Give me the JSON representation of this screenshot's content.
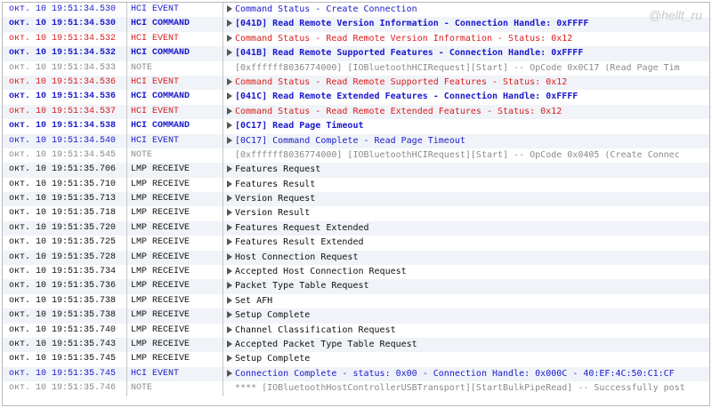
{
  "watermark": "@hellt_ru",
  "colors": {
    "event": "#1a1acc",
    "command": "#1a1acc",
    "error": "#d81c1c",
    "note": "#8a8a8a",
    "lmp": "#111111",
    "row_alt": "#f0f3f8"
  },
  "log_rows": [
    {
      "timestamp": "окт. 10 19:51:34.530",
      "type": "HCI EVENT",
      "message": "Command Status - Create Connection",
      "style": "event",
      "expandable": true
    },
    {
      "timestamp": "окт. 10 19:51:34.530",
      "type": "HCI COMMAND",
      "message": "[041D] Read Remote Version Information - Connection Handle: 0xFFFF",
      "style": "command",
      "expandable": true
    },
    {
      "timestamp": "окт. 10 19:51:34.532",
      "type": "HCI EVENT",
      "message": "Command Status - Read Remote Version Information - Status: 0x12",
      "style": "error",
      "expandable": true
    },
    {
      "timestamp": "окт. 10 19:51:34.532",
      "type": "HCI COMMAND",
      "message": "[041B] Read Remote Supported Features - Connection Handle: 0xFFFF",
      "style": "command",
      "expandable": true
    },
    {
      "timestamp": "окт. 10 19:51:34.533",
      "type": "NOTE",
      "message": "[0xffffff8036774000] [IOBluetoothHCIRequest][Start] --  OpCode 0x0C17 (Read Page Tim",
      "style": "note",
      "expandable": false
    },
    {
      "timestamp": "окт. 10 19:51:34.536",
      "type": "HCI EVENT",
      "message": "Command Status - Read Remote Supported Features - Status: 0x12",
      "style": "error",
      "expandable": true
    },
    {
      "timestamp": "окт. 10 19:51:34.536",
      "type": "HCI COMMAND",
      "message": "[041C] Read Remote Extended Features - Connection Handle: 0xFFFF",
      "style": "command",
      "expandable": true
    },
    {
      "timestamp": "окт. 10 19:51:34.537",
      "type": "HCI EVENT",
      "message": "Command Status - Read Remote Extended Features - Status: 0x12",
      "style": "error",
      "expandable": true
    },
    {
      "timestamp": "окт. 10 19:51:34.538",
      "type": "HCI COMMAND",
      "message": "[0C17] Read Page Timeout",
      "style": "command",
      "expandable": true
    },
    {
      "timestamp": "окт. 10 19:51:34.540",
      "type": "HCI EVENT",
      "message": "[0C17] Command Complete - Read Page Timeout",
      "style": "event",
      "expandable": true
    },
    {
      "timestamp": "окт. 10 19:51:34.545",
      "type": "NOTE",
      "message": "[0xffffff8036774000] [IOBluetoothHCIRequest][Start] --  OpCode 0x0405 (Create Connec",
      "style": "note",
      "expandable": false
    },
    {
      "timestamp": "окт. 10 19:51:35.706",
      "type": "LMP RECEIVE",
      "message": "Features Request",
      "style": "lmp",
      "expandable": true
    },
    {
      "timestamp": "окт. 10 19:51:35.710",
      "type": "LMP RECEIVE",
      "message": "Features Result",
      "style": "lmp",
      "expandable": true
    },
    {
      "timestamp": "окт. 10 19:51:35.713",
      "type": "LMP RECEIVE",
      "message": "Version Request",
      "style": "lmp",
      "expandable": true
    },
    {
      "timestamp": "окт. 10 19:51:35.718",
      "type": "LMP RECEIVE",
      "message": "Version Result",
      "style": "lmp",
      "expandable": true
    },
    {
      "timestamp": "окт. 10 19:51:35.720",
      "type": "LMP RECEIVE",
      "message": "Features Request Extended",
      "style": "lmp",
      "expandable": true
    },
    {
      "timestamp": "окт. 10 19:51:35.725",
      "type": "LMP RECEIVE",
      "message": "Features Result Extended",
      "style": "lmp",
      "expandable": true
    },
    {
      "timestamp": "окт. 10 19:51:35.728",
      "type": "LMP RECEIVE",
      "message": "Host Connection Request",
      "style": "lmp",
      "expandable": true
    },
    {
      "timestamp": "окт. 10 19:51:35.734",
      "type": "LMP RECEIVE",
      "message": "Accepted Host Connection Request",
      "style": "lmp",
      "expandable": true
    },
    {
      "timestamp": "окт. 10 19:51:35.736",
      "type": "LMP RECEIVE",
      "message": "Packet Type Table Request",
      "style": "lmp",
      "expandable": true
    },
    {
      "timestamp": "окт. 10 19:51:35.738",
      "type": "LMP RECEIVE",
      "message": "Set AFH",
      "style": "lmp",
      "expandable": true
    },
    {
      "timestamp": "окт. 10 19:51:35.738",
      "type": "LMP RECEIVE",
      "message": "Setup Complete",
      "style": "lmp",
      "expandable": true
    },
    {
      "timestamp": "окт. 10 19:51:35.740",
      "type": "LMP RECEIVE",
      "message": "Channel Classification Request",
      "style": "lmp",
      "expandable": true
    },
    {
      "timestamp": "окт. 10 19:51:35.743",
      "type": "LMP RECEIVE",
      "message": "Accepted Packet Type Table Request",
      "style": "lmp",
      "expandable": true
    },
    {
      "timestamp": "окт. 10 19:51:35.745",
      "type": "LMP RECEIVE",
      "message": "Setup Complete",
      "style": "lmp",
      "expandable": true
    },
    {
      "timestamp": "окт. 10 19:51:35.745",
      "type": "HCI EVENT",
      "message": "Connection Complete - status: 0x00 - Connection Handle: 0x000C - 40:EF:4C:50:C1:CF",
      "style": "event",
      "expandable": true
    },
    {
      "timestamp": "окт. 10 19:51:35.746",
      "type": "NOTE",
      "message": "**** [IOBluetoothHostControllerUSBTransport][StartBulkPipeRead] -- Successfully post",
      "style": "note",
      "expandable": false
    }
  ]
}
